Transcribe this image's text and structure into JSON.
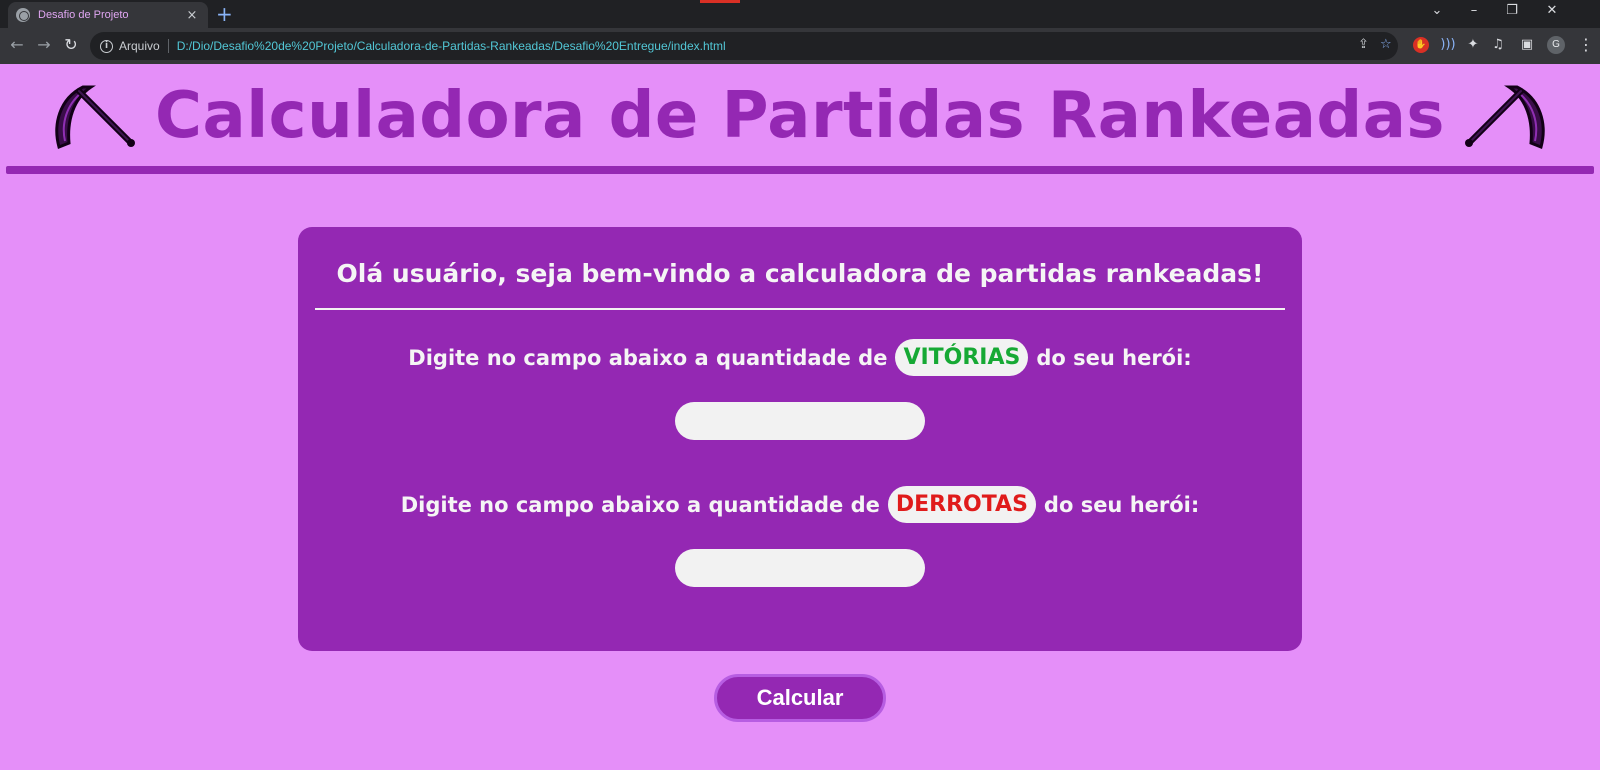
{
  "browser": {
    "tab_title": "Desafio de Projeto",
    "tab_close": "×",
    "new_tab": "+",
    "scheme_label": "Arquivo",
    "url": "D:/Dio/Desafio%20de%20Projeto/Calculadora-de-Partidas-Rankeadas/Desafio%20Entregue/index.html",
    "profile_initial": "G",
    "icons": [
      "back-icon",
      "forward-icon",
      "reload-icon",
      "info-icon",
      "share-icon",
      "bookmark-star-icon",
      "extensions-icon",
      "media-icon",
      "side-panel-icon",
      "menu-icon"
    ]
  },
  "header": {
    "title": "Calculadora de Partidas Rankeadas",
    "title_color": "#9428b3"
  },
  "card": {
    "welcome": "Olá usuário, seja bem-vindo a calculadora de partidas rankeadas!",
    "wins_prompt_before": "Digite no campo abaixo a quantidade de",
    "wins_keyword": "VITÓRIAS",
    "wins_prompt_after": "do seu herói:",
    "wins_value": "",
    "losses_prompt_before": "Digite no campo abaixo a quantidade de",
    "losses_keyword": "DERROTAS",
    "losses_prompt_after": "do seu herói:",
    "losses_value": ""
  },
  "actions": {
    "calculate_label": "Calcular"
  },
  "colors": {
    "page_background": "#e58ff9",
    "card_background": "#9428b3",
    "wins": "#16a934",
    "losses": "#e01b1b"
  }
}
